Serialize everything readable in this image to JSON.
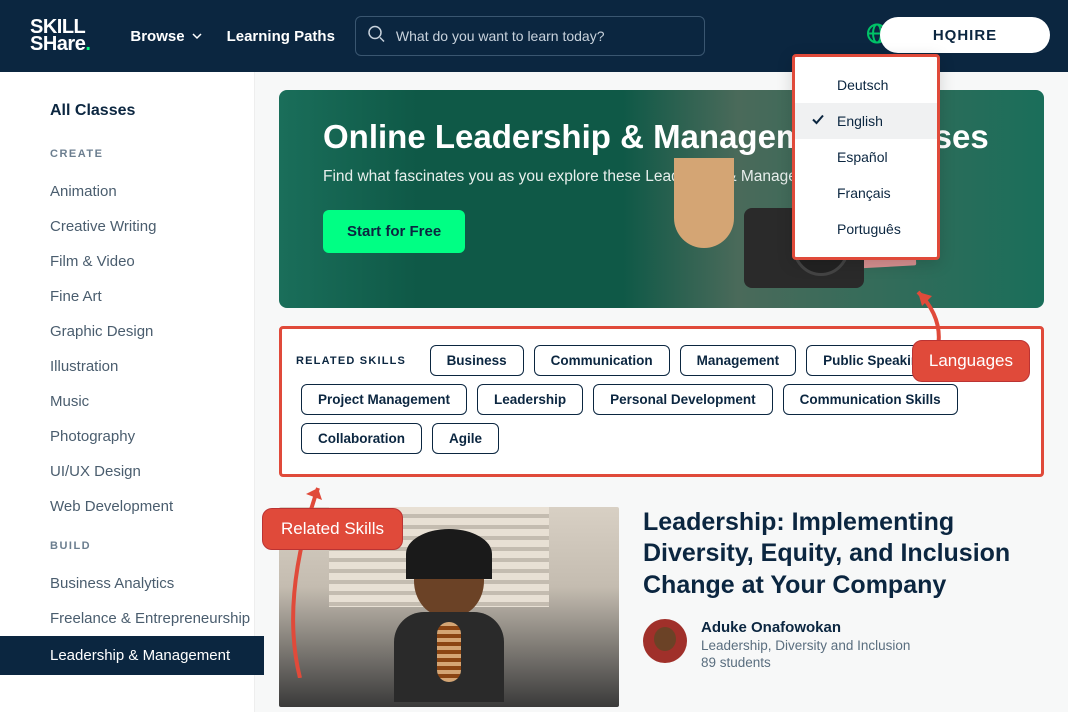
{
  "header": {
    "logo_top": "SKILL",
    "logo_bottom": "SHare",
    "browse": "Browse",
    "learning_paths": "Learning Paths",
    "search_placeholder": "What do you want to learn today?",
    "hqhire": "HQHIRE"
  },
  "sidebar": {
    "all": "All Classes",
    "sections": [
      {
        "title": "CREATE",
        "items": [
          "Animation",
          "Creative Writing",
          "Film & Video",
          "Fine Art",
          "Graphic Design",
          "Illustration",
          "Music",
          "Photography",
          "UI/UX Design",
          "Web Development"
        ]
      },
      {
        "title": "BUILD",
        "items": [
          "Business Analytics",
          "Freelance & Entrepreneurship",
          "Leadership & Management"
        ]
      }
    ],
    "active": "Leadership & Management"
  },
  "hero": {
    "title": "Online Leadership & Management Classes",
    "subtitle": "Find what fascinates you as you explore these Leadership & Management classes.",
    "cta": "Start for Free"
  },
  "related_skills": {
    "label": "RELATED SKILLS",
    "pills": [
      "Business",
      "Communication",
      "Management",
      "Public Speaking",
      "Project Management",
      "Leadership",
      "Personal Development",
      "Communication Skills",
      "Collaboration",
      "Agile"
    ]
  },
  "language_dropdown": {
    "items": [
      "Deutsch",
      "English",
      "Español",
      "Français",
      "Português"
    ],
    "selected": "English"
  },
  "annotations": {
    "related_skills": "Related Skills",
    "languages": "Languages"
  },
  "course": {
    "title": "Leadership: Implementing Diversity, Equity, and Inclusion Change at Your Company",
    "author_name": "Aduke Onafowokan",
    "author_sub": "Leadership, Diversity and Inclusion",
    "students": "89 students"
  },
  "colors": {
    "primary_dark": "#0b2640",
    "accent_green": "#00ff84",
    "annotation_red": "#e04a3a"
  }
}
